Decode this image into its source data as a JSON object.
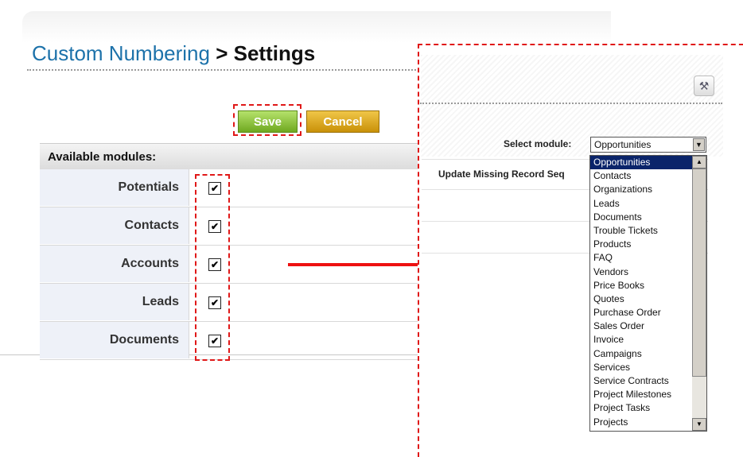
{
  "header": {
    "title_link": "Custom Numbering",
    "title_rest": " > Settings"
  },
  "buttons": {
    "save": "Save",
    "cancel": "Cancel"
  },
  "modules": {
    "header": "Available modules:",
    "rows": [
      {
        "label": "Potentials",
        "checked": true
      },
      {
        "label": "Contacts",
        "checked": true
      },
      {
        "label": "Accounts",
        "checked": true
      },
      {
        "label": "Leads",
        "checked": true
      },
      {
        "label": "Documents",
        "checked": true
      }
    ]
  },
  "checkbox_glyph": "✔",
  "right_panel": {
    "select_label": "Select module:",
    "selected_module": "Opportunities",
    "update_label": "Update Missing Record Seq",
    "dropdown_options": [
      "Opportunities",
      "Contacts",
      "Organizations",
      "Leads",
      "Documents",
      "Trouble Tickets",
      "Products",
      "FAQ",
      "Vendors",
      "Price Books",
      "Quotes",
      "Purchase Order",
      "Sales Order",
      "Invoice",
      "Campaigns",
      "Services",
      "Service Contracts",
      "Project Milestones",
      "Project Tasks",
      "Projects"
    ],
    "tools_icon": "hammer-icon"
  },
  "colors": {
    "annotation_red": "#e01818",
    "link_blue": "#1d72aa",
    "save_green": "#8cc63f",
    "cancel_orange": "#e8b020",
    "selection_navy": "#0a246a"
  }
}
